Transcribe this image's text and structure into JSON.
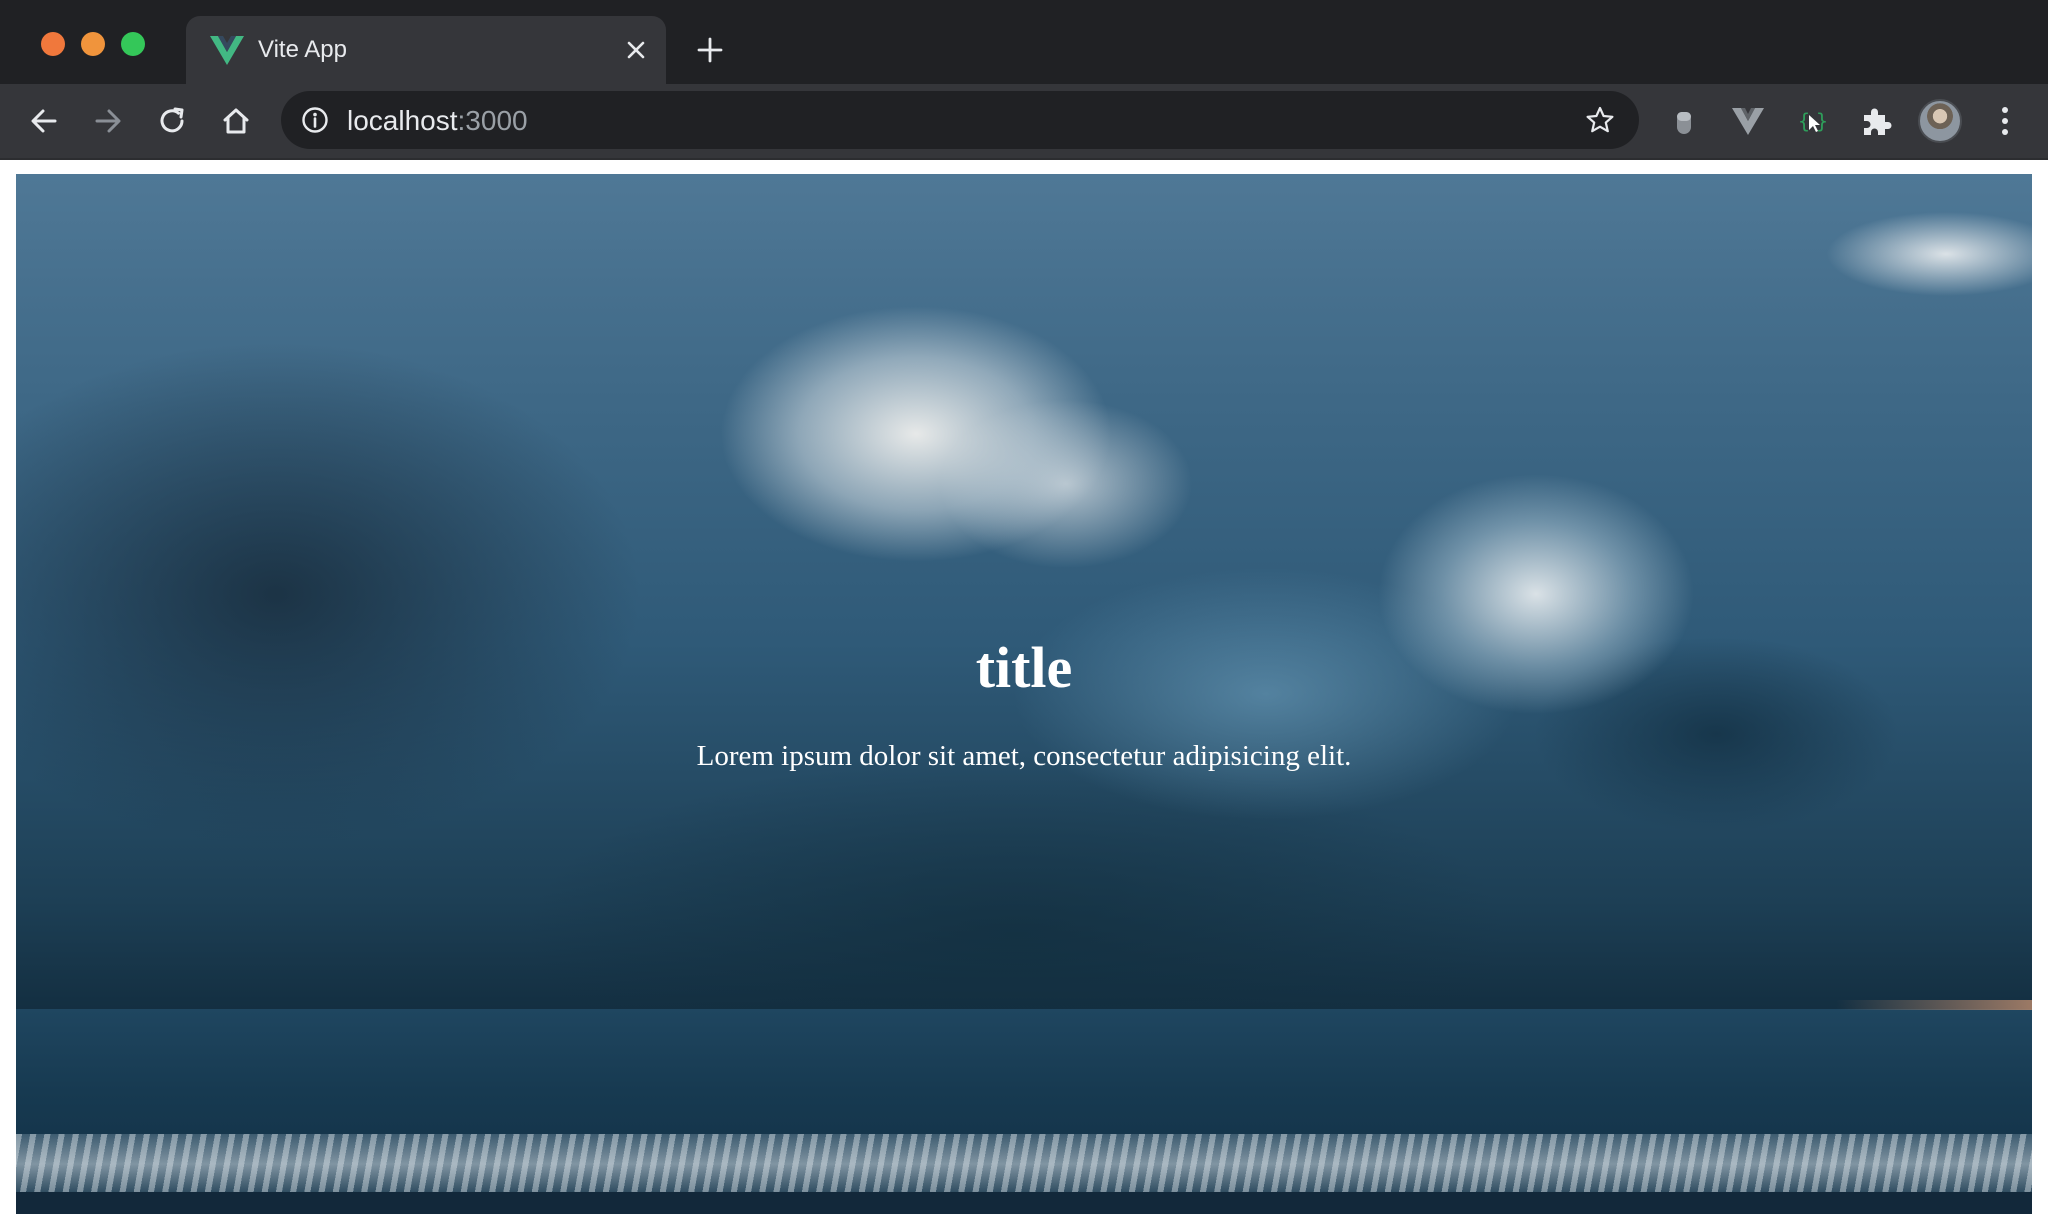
{
  "browser": {
    "tab": {
      "title": "Vite App",
      "favicon": "vue-logo-icon"
    },
    "address_bar": {
      "host": "localhost",
      "port": ":3000"
    },
    "icons": {
      "back": "arrow-left-icon",
      "forward": "arrow-right-icon",
      "reload": "reload-icon",
      "home": "home-icon",
      "info": "info-icon",
      "bookmark": "star-icon",
      "new_tab": "plus-icon",
      "close_tab": "close-icon",
      "extensions": [
        "extension-bulb-icon",
        "vue-devtools-icon",
        "extension-code-icon",
        "puzzle-icon"
      ],
      "profile": "avatar",
      "menu": "more-vert-icon"
    },
    "colors": {
      "frame": "#202124",
      "toolbar": "#35363a",
      "vue_green": "#42b883",
      "url_text": "#e8eaed",
      "url_port": "#9aa0a6"
    }
  },
  "page": {
    "hero": {
      "title": "title",
      "subtitle": "Lorem ipsum dolor sit amet, consectetur adipisicing elit."
    }
  }
}
